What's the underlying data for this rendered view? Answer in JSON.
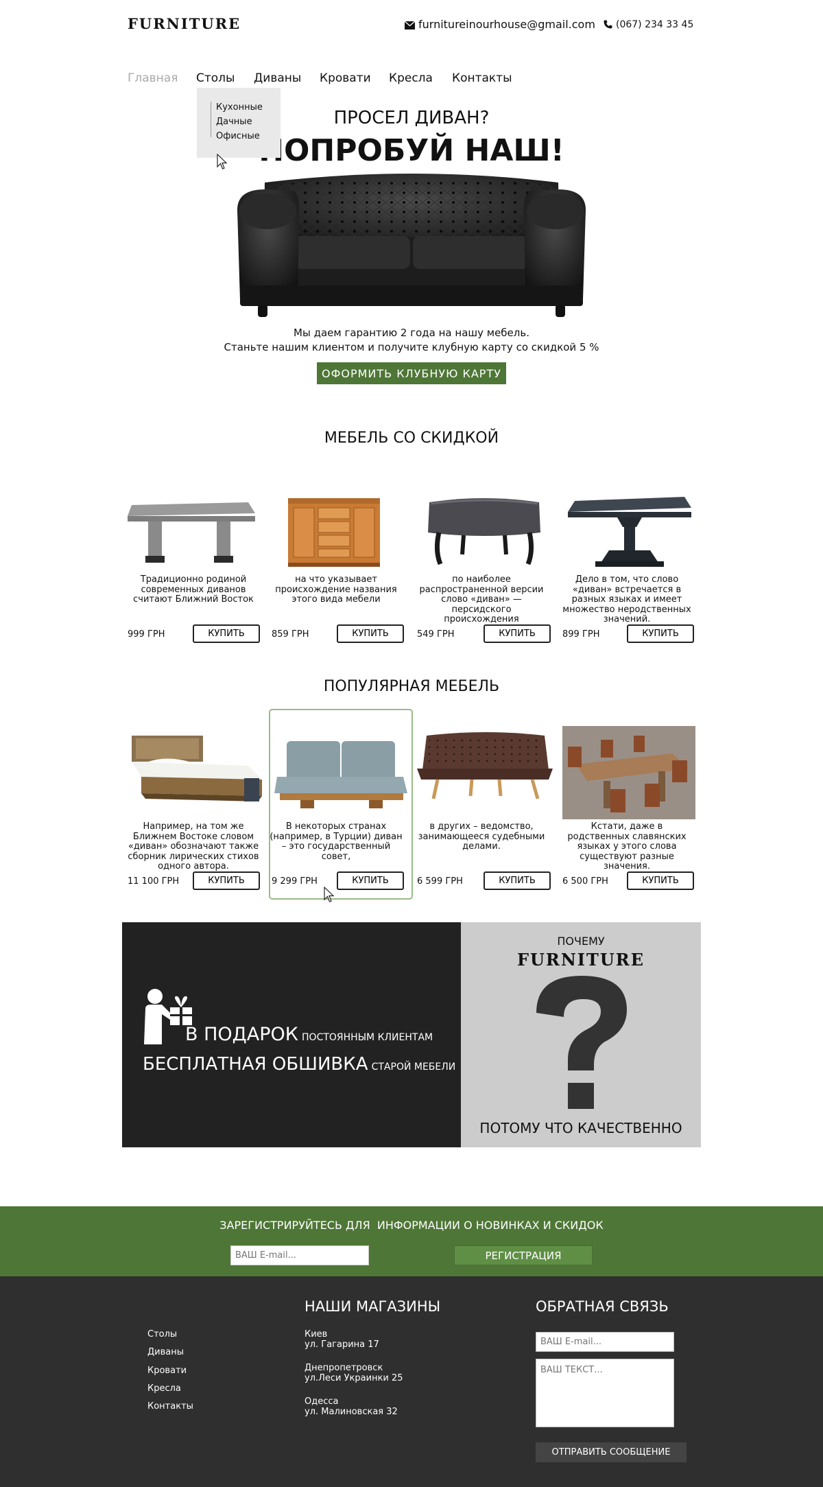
{
  "header": {
    "logo": "FURNITURE",
    "email": "furnitureinourhouse@gmail.com",
    "phone": "(067) 234 33 45"
  },
  "nav": {
    "items": [
      "Главная",
      "Столы",
      "Диваны",
      "Кровати",
      "Кресла",
      "Контакты"
    ],
    "dropdown": [
      "Кухонные",
      "Дачные",
      "Офисные"
    ]
  },
  "hero": {
    "line1": "ПРОСЕЛ ДИВАН?",
    "line2": "ПОПРОБУЙ НАШ!",
    "text1": "Мы даем гарантию 2 года на нашу мебель.",
    "text2": "Станьте нашим клиентом и получите клубную карту со скидкой 5 %",
    "button": "ОФОРМИТЬ КЛУБНУЮ КАРТУ"
  },
  "discount": {
    "title": "МЕБЕЛЬ СО СКИДКОЙ",
    "buy_label": "КУПИТЬ",
    "items": [
      {
        "desc": "Традиционно родиной современных диванов считают Ближний Восток",
        "price": "999 ГРН"
      },
      {
        "desc": "на что указывает происхождение названия этого вида мебели",
        "price": "859 ГРН"
      },
      {
        "desc": "по наиболее распространенной версии слово «диван» — персидского происхождения",
        "price": "549 ГРН"
      },
      {
        "desc": "Дело в том, что слово «диван» встречается в разных языках и имеет множество неродственных значений.",
        "price": "899 ГРН"
      }
    ]
  },
  "popular": {
    "title": "ПОПУЛЯРНАЯ МЕБЕЛЬ",
    "buy_label": "КУПИТЬ",
    "items": [
      {
        "desc": "Например, на том же Ближнем Востоке словом «диван» обозначают также сборник лирических стихов одного автора.",
        "price": "11 100 ГРН"
      },
      {
        "desc": "В некоторых странах (например, в Турции) диван – это государственный совет,",
        "price": "9 299 ГРН"
      },
      {
        "desc": "в других – ведомство, занимающееся судебными делами.",
        "price": "6 599 ГРН"
      },
      {
        "desc": "Кстати, даже в родственных славянских языках у этого слова существуют разные значения.",
        "price": "6 500 ГРН"
      }
    ]
  },
  "banner": {
    "gift_big": "В ПОДАРОК",
    "gift_small": "постоянным клиентам",
    "upholstery_big": "БЕСПЛАТНАЯ ОБШИВКА",
    "upholstery_small": "старой мебели",
    "why": "ПОЧЕМУ",
    "brand": "FURNITURE",
    "answer": "ПОТОМУ ЧТО КАЧЕСТВЕННО"
  },
  "subscribe": {
    "title": "ЗАРЕГИСТРИРУЙТЕСЬ ДЛЯ  ИНФОРМАЦИИ О НОВИНКАХ И СКИДОК",
    "placeholder": "ВАШ E-mail...",
    "button": "РЕГИСТРАЦИЯ"
  },
  "footer": {
    "links": [
      "Столы",
      "Диваны",
      "Кровати",
      "Кресла",
      "Контакты"
    ],
    "stores_title": "НАШИ МАГАЗИНЫ",
    "stores": [
      {
        "city": "Киев",
        "address": "ул. Гагарина 17"
      },
      {
        "city": "Днепропетровск",
        "address": "ул.Леси Украинки 25"
      },
      {
        "city": "Одесса",
        "address": "ул. Малиновская 32"
      }
    ],
    "feedback_title": "ОБРАТНАЯ СВЯЗЬ",
    "email_placeholder": "ВАШ E-mail...",
    "text_placeholder": "ВАШ ТЕКСТ...",
    "send_button": "ОТПРАВИТЬ СООБЩЕНИЕ"
  },
  "colors": {
    "accent_green": "#4e7636",
    "dark": "#2f2f2f",
    "banner_dark": "#222222",
    "banner_grey": "#cccccc"
  }
}
